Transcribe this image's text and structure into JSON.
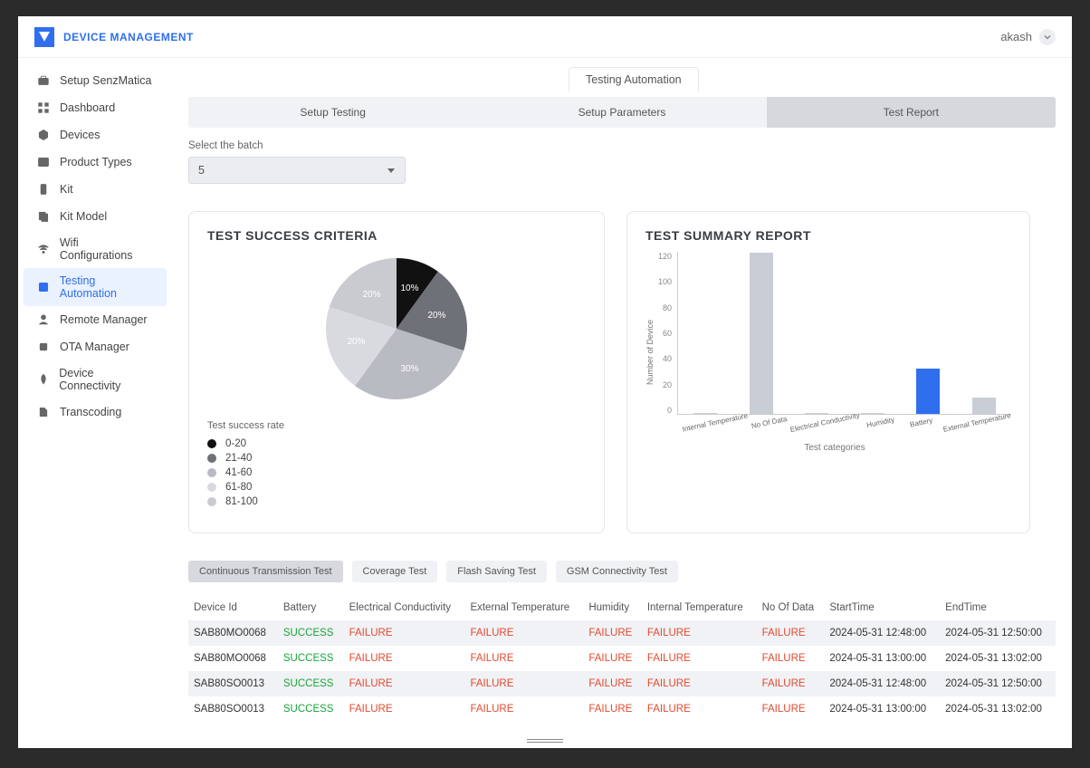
{
  "header": {
    "title": "DEVICE MANAGEMENT",
    "user": "akash"
  },
  "sidebar": {
    "items": [
      {
        "label": "Setup SenzMatica",
        "icon": "briefcase"
      },
      {
        "label": "Dashboard",
        "icon": "grid"
      },
      {
        "label": "Devices",
        "icon": "hex"
      },
      {
        "label": "Product Types",
        "icon": "list"
      },
      {
        "label": "Kit",
        "icon": "phone"
      },
      {
        "label": "Kit Model",
        "icon": "copy"
      },
      {
        "label": "Wifi Configurations",
        "icon": "wifi"
      },
      {
        "label": "Testing Automation",
        "icon": "target",
        "active": true
      },
      {
        "label": "Remote Manager",
        "icon": "person"
      },
      {
        "label": "OTA Manager",
        "icon": "chip"
      },
      {
        "label": "Device Connectivity",
        "icon": "rocket"
      },
      {
        "label": "Transcoding",
        "icon": "bookmark"
      }
    ]
  },
  "page_tab": "Testing Automation",
  "subtabs": {
    "items": [
      "Setup Testing",
      "Setup Parameters",
      "Test Report"
    ],
    "active": 2
  },
  "batch": {
    "label": "Select the batch",
    "value": "5"
  },
  "pie_card": {
    "title": "TEST SUCCESS CRITERIA",
    "legend_title": "Test success rate",
    "legend": [
      {
        "label": "0-20",
        "color": "#111111"
      },
      {
        "label": "21-40",
        "color": "#6f7178"
      },
      {
        "label": "41-60",
        "color": "#b8bbc2"
      },
      {
        "label": "61-80",
        "color": "#d8dadf"
      },
      {
        "label": "81-100",
        "color": "#c9cbd1"
      }
    ]
  },
  "bar_card": {
    "title": "TEST SUMMARY REPORT",
    "ylabel": "Number of Device",
    "xlabel": "Test categories"
  },
  "chart_data": [
    {
      "type": "pie",
      "title": "TEST SUCCESS CRITERIA",
      "series": [
        {
          "name": "0-20",
          "value": 10,
          "label": "10%",
          "color": "#111111"
        },
        {
          "name": "21-40",
          "value": 20,
          "label": "20%",
          "color": "#6f7178"
        },
        {
          "name": "41-60",
          "value": 30,
          "label": "30%",
          "color": "#b8bbc2"
        },
        {
          "name": "61-80",
          "value": 20,
          "label": "20%",
          "color": "#d8dadf"
        },
        {
          "name": "81-100",
          "value": 20,
          "label": "20%",
          "color": "#c9cbd1"
        }
      ]
    },
    {
      "type": "bar",
      "title": "TEST SUMMARY REPORT",
      "ylabel": "Number of Device",
      "xlabel": "Test categories",
      "ylim": [
        0,
        120
      ],
      "yticks": [
        0,
        20,
        40,
        60,
        80,
        100,
        120
      ],
      "categories": [
        "Internal Temperature",
        "No Of Data",
        "Electrical Conductivity",
        "Humidity",
        "Battery",
        "External Temperature"
      ],
      "values": [
        1,
        120,
        1,
        1,
        34,
        12
      ],
      "colors": [
        "#c9cdd6",
        "#c9cdd6",
        "#c9cdd6",
        "#c9cdd6",
        "#2f6fed",
        "#c9cdd6"
      ]
    }
  ],
  "result_tabs": {
    "items": [
      "Continuous Transmission Test",
      "Coverage Test",
      "Flash Saving Test",
      "GSM Connectivity Test"
    ],
    "active": 0
  },
  "results": {
    "columns": [
      "Device Id",
      "Battery",
      "Electrical Conductivity",
      "External Temperature",
      "Humidity",
      "Internal Temperature",
      "No Of Data",
      "StartTime",
      "EndTime"
    ],
    "rows": [
      {
        "cells": [
          "SAB80MO0068",
          "SUCCESS",
          "FAILURE",
          "FAILURE",
          "FAILURE",
          "FAILURE",
          "FAILURE",
          "2024-05-31 12:48:00",
          "2024-05-31 12:50:00"
        ]
      },
      {
        "cells": [
          "SAB80MO0068",
          "SUCCESS",
          "FAILURE",
          "FAILURE",
          "FAILURE",
          "FAILURE",
          "FAILURE",
          "2024-05-31 13:00:00",
          "2024-05-31 13:02:00"
        ]
      },
      {
        "cells": [
          "SAB80SO0013",
          "SUCCESS",
          "FAILURE",
          "FAILURE",
          "FAILURE",
          "FAILURE",
          "FAILURE",
          "2024-05-31 12:48:00",
          "2024-05-31 12:50:00"
        ]
      },
      {
        "cells": [
          "SAB80SO0013",
          "SUCCESS",
          "FAILURE",
          "FAILURE",
          "FAILURE",
          "FAILURE",
          "FAILURE",
          "2024-05-31 13:00:00",
          "2024-05-31 13:02:00"
        ]
      }
    ]
  }
}
